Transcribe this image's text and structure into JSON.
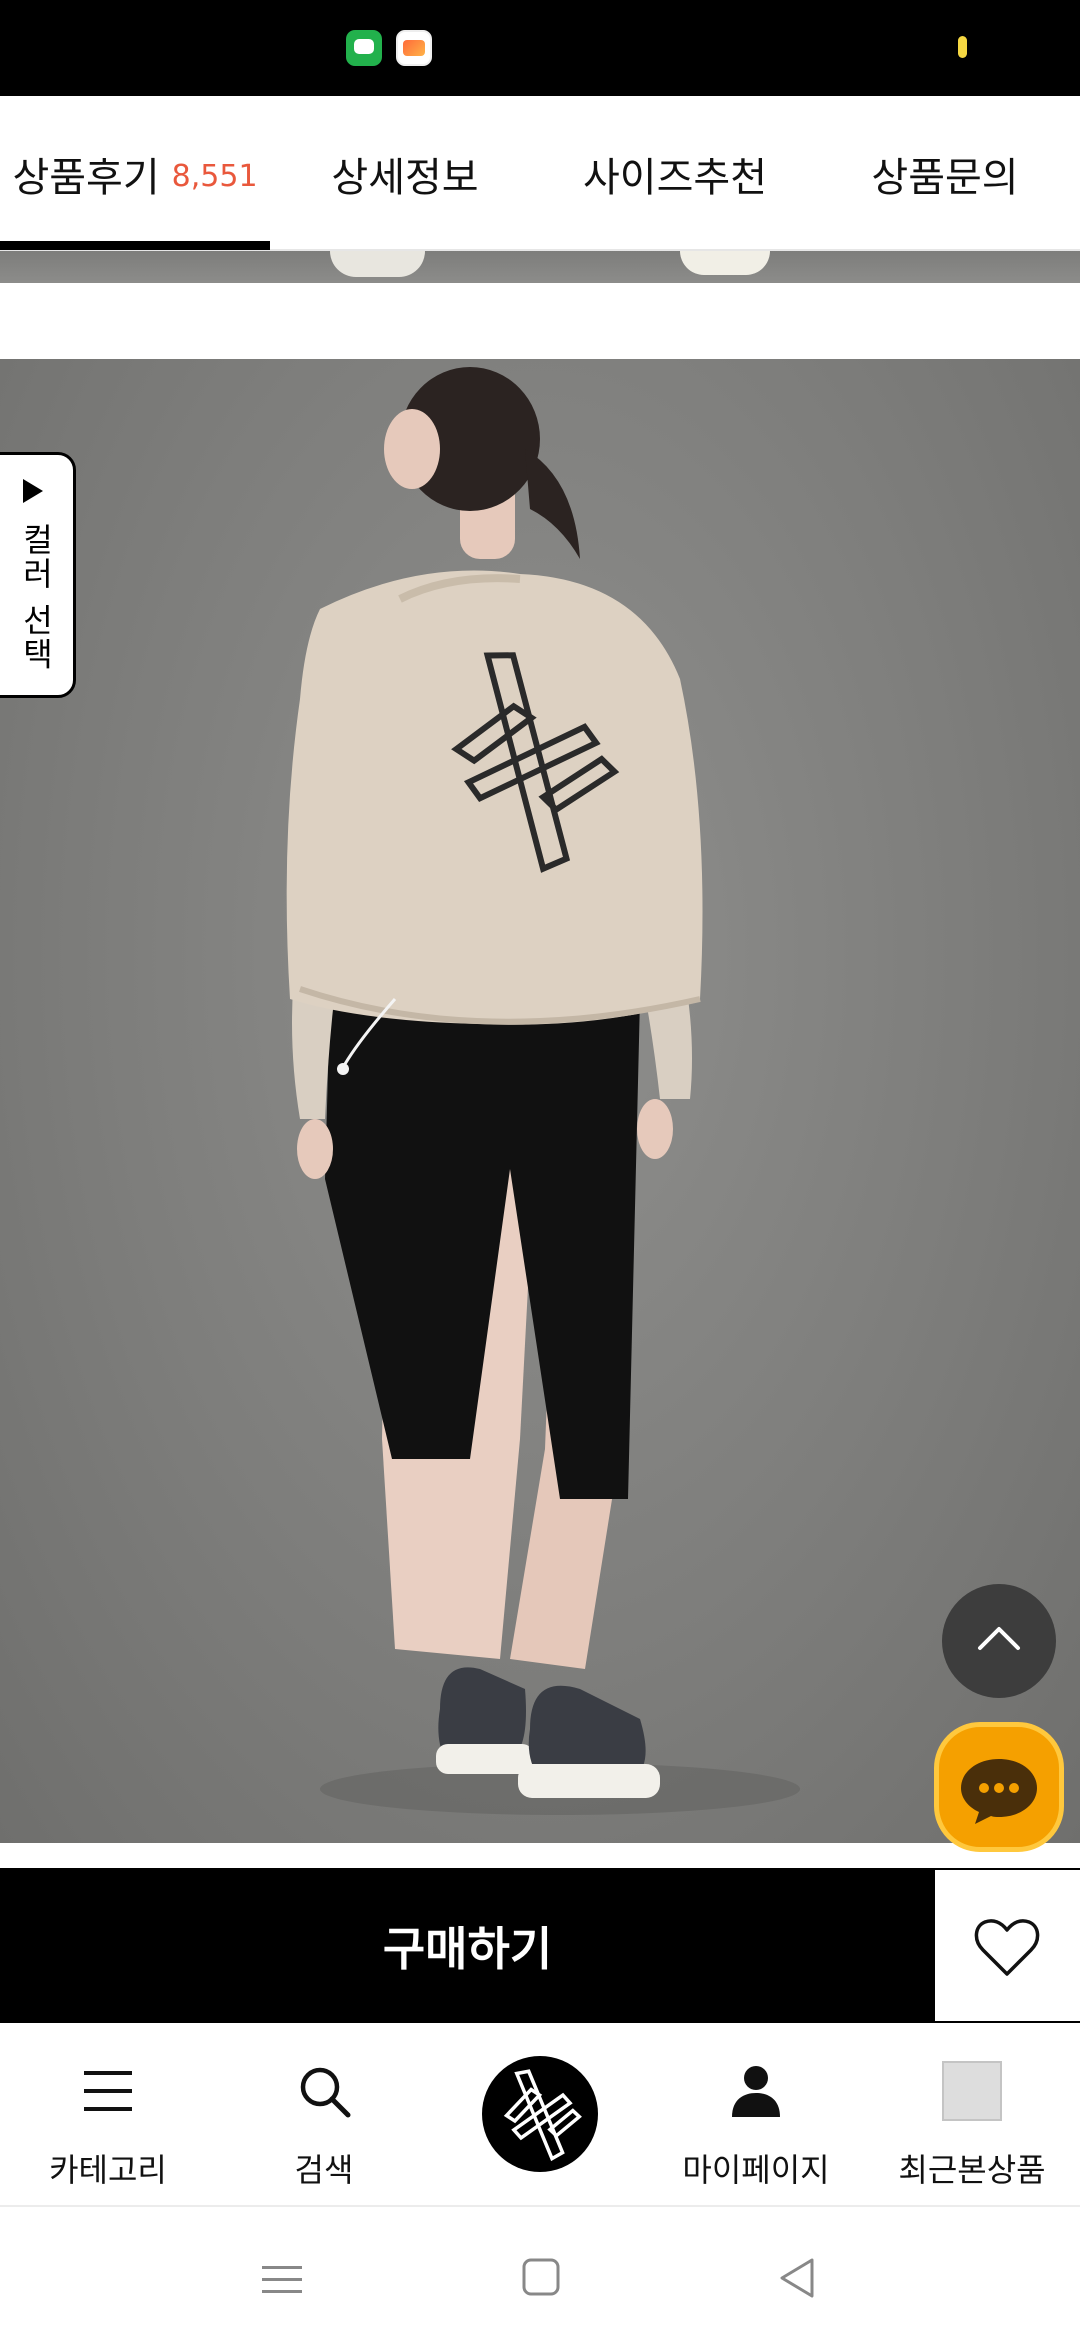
{
  "tabs": {
    "reviews": {
      "label": "상품후기",
      "count": "8,551"
    },
    "details": {
      "label": "상세정보"
    },
    "size": {
      "label": "사이즈추천"
    },
    "qna": {
      "label": "상품문의"
    },
    "active": "reviews"
  },
  "color_select": {
    "label": "컬러 선택"
  },
  "buy": {
    "label": "구매하기"
  },
  "bottom_nav": {
    "items": [
      {
        "label": "카테고리",
        "icon": "menu-icon"
      },
      {
        "label": "검색",
        "icon": "search-icon"
      },
      {
        "label": "",
        "icon": "brand-logo-icon"
      },
      {
        "label": "마이페이지",
        "icon": "person-icon"
      },
      {
        "label": "최근본상품",
        "icon": "recent-thumbnail-icon"
      }
    ]
  },
  "colors": {
    "accent_count": "#e9583c",
    "chat_button": "#f5a000",
    "buy_button": "#000000",
    "scroll_top": "#3d3d3d"
  }
}
